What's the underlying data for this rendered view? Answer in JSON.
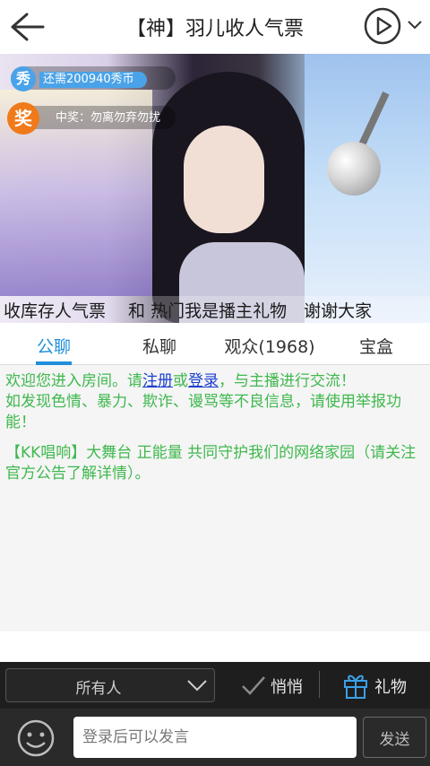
{
  "header": {
    "title": "【神】羽儿收人气票"
  },
  "video": {
    "banner_text": "收库存人气票　 和 热门我是播主礼物　谢谢大家",
    "xiu_badge": {
      "icon_text": "秀",
      "text": "还需200940秀币"
    },
    "prize_badge": {
      "icon_text": "奖",
      "text": "中奖：勿离勿弃勿扰"
    }
  },
  "tabs": [
    {
      "label": "公聊",
      "active": true
    },
    {
      "label": "私聊",
      "active": false
    },
    {
      "label": "观众(1968)",
      "active": false
    },
    {
      "label": "宝盒",
      "active": false
    }
  ],
  "chat": {
    "welcome_prefix": "欢迎您进入房间。请",
    "register_link": "注册",
    "or_text": "或",
    "login_link": "登录",
    "welcome_suffix": "，与主播进行交流！",
    "notice": "如发现色情、暴力、欺诈、谩骂等不良信息，请使用举报功能！",
    "announcement": "【KK唱响】大舞台 正能量 共同守护我们的网络家园（请关注官方公告了解详情）。"
  },
  "controls": {
    "recipient": "所有人",
    "whisper_label": "悄悄",
    "gift_label": "礼物",
    "input_placeholder": "登录后可以发言",
    "send_label": "发送"
  },
  "colors": {
    "accent": "#1e8fdb",
    "chat_text": "#3fb84e",
    "link": "#1c3fd0",
    "prize_icon": "#f07a1a",
    "xiu_icon": "#4aa3e8"
  }
}
